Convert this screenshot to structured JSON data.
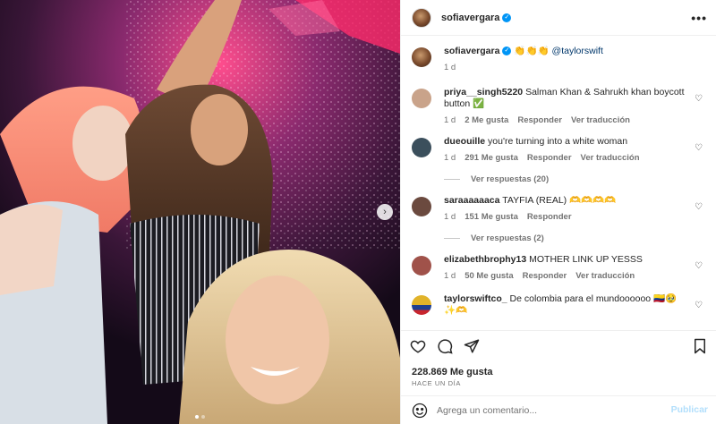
{
  "post": {
    "username": "sofiavergara",
    "caption_emoji": "👏👏👏",
    "caption_mention": "@taylorswift",
    "caption_time": "1 d",
    "likes": "228.869 Me gusta",
    "time_ago": "HACE UN DÍA",
    "more_label": "•••",
    "next_label": "›"
  },
  "comments": [
    {
      "user": "priya__singh5220",
      "text": "Salman Khan & Sahrukh khan boycott button ✅",
      "time": "1 d",
      "likes": "2 Me gusta",
      "reply": "Responder",
      "translate": "Ver traducción",
      "avatar_color": "#c9a38a"
    },
    {
      "user": "dueouille",
      "text": "you're turning into a white woman",
      "time": "1 d",
      "likes": "291 Me gusta",
      "reply": "Responder",
      "translate": "Ver traducción",
      "view_replies": "Ver respuestas (20)",
      "avatar_color": "#3b4f5c"
    },
    {
      "user": "saraaaaaaca",
      "text": "TAYFIA (REAL) 🫶🫶🫶🫶",
      "time": "1 d",
      "likes": "151 Me gusta",
      "reply": "Responder",
      "view_replies": "Ver respuestas (2)",
      "avatar_color": "#6b4a3f"
    },
    {
      "user": "elizabethbrophy13",
      "text": "MOTHER LINK UP YESSS",
      "time": "1 d",
      "likes": "50 Me gusta",
      "reply": "Responder",
      "translate": "Ver traducción",
      "avatar_color": "#a0524a"
    },
    {
      "user": "taylorswiftco_",
      "text": "De colombia para el mundoooooo 🇨🇴🥹✨🫶",
      "avatar_color": "#e1b32a"
    }
  ],
  "composer": {
    "placeholder": "Agrega un comentario...",
    "post_label": "Publicar"
  },
  "icons": [
    "heart-icon",
    "comment-icon",
    "share-icon",
    "bookmark-icon",
    "emoji-icon",
    "verified-icon",
    "more-icon"
  ],
  "colors": {
    "verified": "#0095f6",
    "mention": "#00376b",
    "post_button": "#b2dffc",
    "muted": "#737373"
  }
}
